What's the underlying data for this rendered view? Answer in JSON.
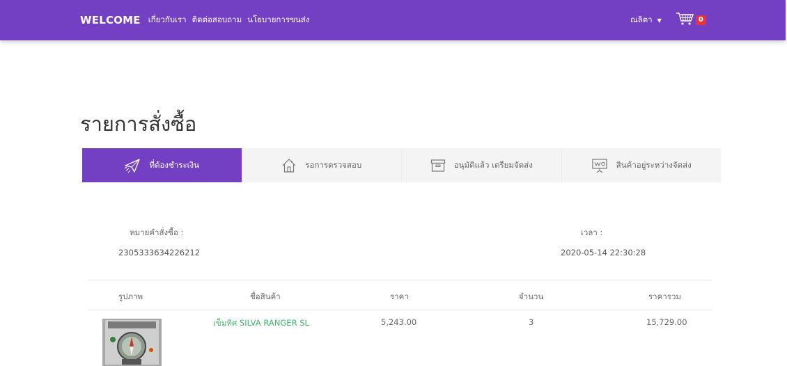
{
  "navbar": {
    "brand": "WELCOME",
    "links": [
      "เกี่ยวกับเรา",
      "ติดต่อสอบถาม",
      "นโยบายการขนส่ง"
    ],
    "user_name": "ณลิตา",
    "cart_count": "0",
    "bg_color": "#7340c4"
  },
  "page": {
    "title": "รายการสั่งซื้อ"
  },
  "tabs": [
    {
      "label": "ที่ต้องชำระเงิน",
      "icon": "airplane-icon",
      "active": true
    },
    {
      "label": "รอการตรวจสอบ",
      "icon": "house-icon",
      "active": false
    },
    {
      "label": "อนุมัติแล้ว เตรียมจัดส่ง",
      "icon": "archive-box-icon",
      "active": false
    },
    {
      "label": "สินค้าอยู่ระหว่างจัดส่ง",
      "icon": "presentation-board-icon",
      "active": false
    }
  ],
  "order": {
    "number_label": "หมายคำสั่งซื้อ :",
    "number": "2305333634226212",
    "time_label": "เวลา :",
    "time": "2020-05-14 22:30:28"
  },
  "table": {
    "headers": [
      "รูปภาพ",
      "ชื่อสินค้า",
      "ราคา",
      "จำนวน",
      "ราคารวม"
    ],
    "rows": [
      {
        "image": "compass-product-photo",
        "name": "เข็มทิศ SILVA RANGER SL",
        "price": "5,243.00",
        "qty": "3",
        "total": "15,729.00"
      }
    ],
    "name_color": "#3db26b"
  }
}
